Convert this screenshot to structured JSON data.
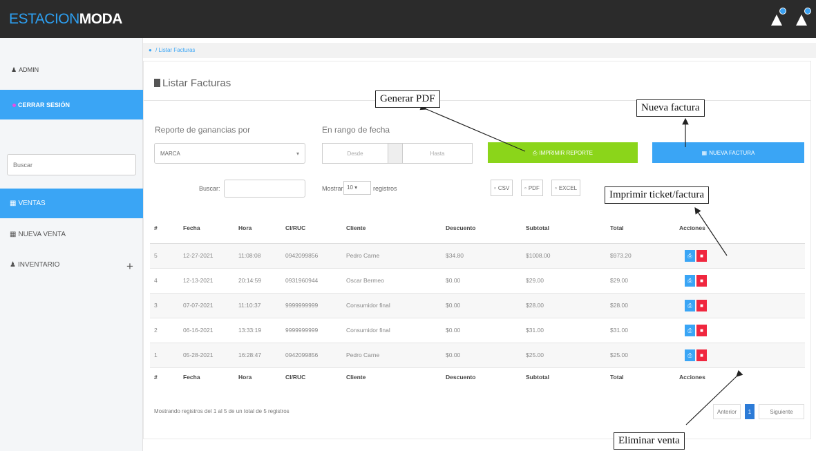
{
  "brand": {
    "part1": "ESTACION",
    "part2": "MODA"
  },
  "topbar": {
    "icons": [
      "bell-icon",
      "bell-icon"
    ]
  },
  "sidebar": {
    "admin": "ADMIN",
    "logout": "CERRAR SESIÓN",
    "search_placeholder": "Buscar",
    "ventas": "VENTAS",
    "nueva_venta": "NUEVA VENTA",
    "inventario": "INVENTARIO",
    "expand": "+"
  },
  "breadcrumb": "Listar Facturas",
  "panel": {
    "title": "Listar Facturas",
    "report_label": "Reporte de ganancias por",
    "report_value": "MARCA",
    "date_label": "En rango de fecha",
    "from_placeholder": "Desde",
    "to_placeholder": "Hasta",
    "print_report": "IMPRIMIR REPORTE",
    "new_invoice": "NUEVA FACTURA"
  },
  "table_controls": {
    "search_label": "Buscar:",
    "show_label": "Mostrar",
    "show_value": "10",
    "records_label": "registros",
    "csv": "CSV",
    "pdf": "PDF",
    "excel": "EXCEL"
  },
  "table": {
    "headers": [
      "#",
      "Fecha",
      "Hora",
      "CI/RUC",
      "Cliente",
      "Descuento",
      "Subtotal",
      "Total",
      "Acciones"
    ],
    "rows": [
      [
        "5",
        "12-27-2021",
        "11:08:08",
        "0942099856",
        "Pedro Carne",
        "$34.80",
        "$1008.00",
        "$973.20"
      ],
      [
        "4",
        "12-13-2021",
        "20:14:59",
        "0931960944",
        "Oscar Bermeo",
        "$0.00",
        "$29.00",
        "$29.00"
      ],
      [
        "3",
        "07-07-2021",
        "11:10:37",
        "9999999999",
        "Consumidor final",
        "$0.00",
        "$28.00",
        "$28.00"
      ],
      [
        "2",
        "06-16-2021",
        "13:33:19",
        "9999999999",
        "Consumidor final",
        "$0.00",
        "$31.00",
        "$31.00"
      ],
      [
        "1",
        "05-28-2021",
        "16:28:47",
        "0942099856",
        "Pedro Carne",
        "$0.00",
        "$25.00",
        "$25.00"
      ]
    ]
  },
  "footer": {
    "info": "Mostrando registros del 1 al 5 de un total de 5 registros",
    "prev": "Anterior",
    "page": "1",
    "next": "Siguiente"
  },
  "callouts": {
    "pdf": "Generar PDF",
    "new_invoice": "Nueva factura",
    "ticket": "Imprimir ticket/factura",
    "delete": "Eliminar venta"
  }
}
